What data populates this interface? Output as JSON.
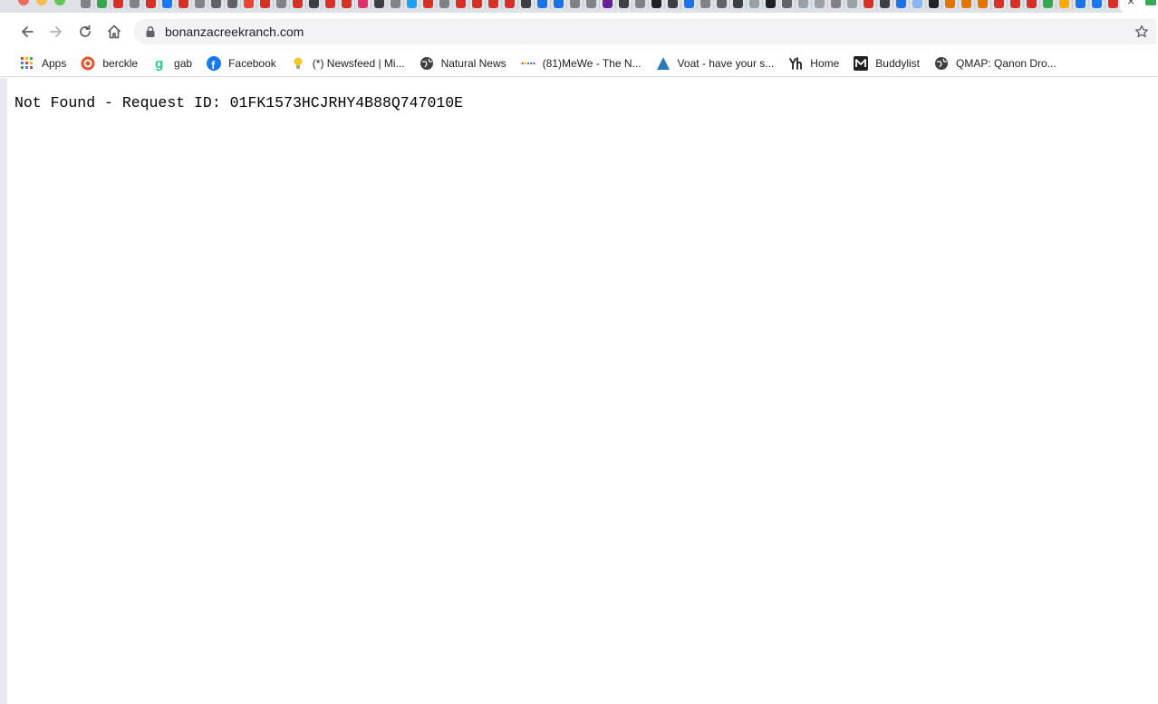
{
  "browser": {
    "address_bar": {
      "url": "bonanzacreekranch.com"
    },
    "pinned_tab_colors": [
      "#7f8387",
      "#34a853",
      "#d93025",
      "#7f8387",
      "#d93025",
      "#1877f2",
      "#d93025",
      "#7f8387",
      "#5f6368",
      "#5f6368",
      "#ea4335",
      "#d93025",
      "#7f8387",
      "#d93025",
      "#3c4043",
      "#d93025",
      "#d93025",
      "#e1306c",
      "#3c4043",
      "#7f8387",
      "#1da1f2",
      "#d93025",
      "#7f8387",
      "#d93025",
      "#d93025",
      "#d93025",
      "#d93025",
      "#3c4043",
      "#1a73e8",
      "#1a73e8",
      "#7f8387",
      "#7f8387",
      "#6a1b9a",
      "#3c4043",
      "#7f8387",
      "#202124",
      "#3c4043",
      "#1a73e8",
      "#7f8387",
      "#5f6368",
      "#3c4043",
      "#9aa0a6",
      "#202124",
      "#5f6368",
      "#9aa0a6",
      "#9aa0a6",
      "#7f8387",
      "#9aa0a6",
      "#d93025",
      "#3c4043",
      "#1a73e8",
      "#8ab4f8",
      "#202124",
      "#e37400",
      "#e37400",
      "#e37400",
      "#d93025",
      "#d93025",
      "#d93025",
      "#34a853",
      "#f9ab00",
      "#1a73e8",
      "#1877f2",
      "#d93025"
    ],
    "active_tab": {
      "favicon_color": "#34a853"
    }
  },
  "bookmarks": [
    {
      "label": "Apps",
      "icon": "apps-grid-icon"
    },
    {
      "label": "berckle",
      "icon": "duckduckgo-icon",
      "color": "#de5833"
    },
    {
      "label": "gab",
      "icon": "gab-icon",
      "color": "#21cf7a"
    },
    {
      "label": "Facebook",
      "icon": "facebook-icon",
      "color": "#1877f2"
    },
    {
      "label": "(*) Newsfeed | Mi...",
      "icon": "lightbulb-icon",
      "color": "#f9c623"
    },
    {
      "label": "Natural News",
      "icon": "globe-icon",
      "color": "#3c4043"
    },
    {
      "label": "(81)MeWe - The N...",
      "icon": "mewe-dots-icon"
    },
    {
      "label": "Voat - have your s...",
      "icon": "voat-triangle-icon",
      "color": "#2a7ab8"
    },
    {
      "label": "Home",
      "icon": "yh-logo-icon",
      "color": "#202124"
    },
    {
      "label": "Buddylist",
      "icon": "buddylist-icon",
      "color": "#202124"
    },
    {
      "label": "QMAP: Qanon Dro...",
      "icon": "globe-icon",
      "color": "#3c4043"
    }
  ],
  "page": {
    "error_text": "Not Found - Request ID: 01FK1573HCJRHY4B88Q747010E"
  }
}
